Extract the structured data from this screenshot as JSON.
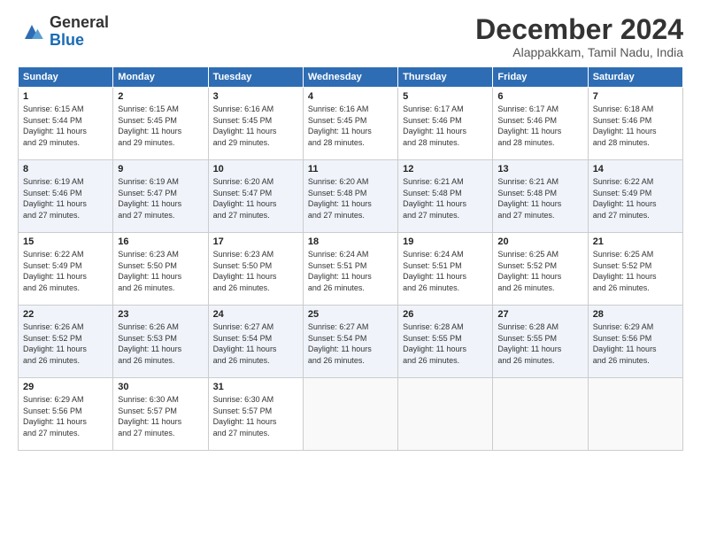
{
  "header": {
    "logo_general": "General",
    "logo_blue": "Blue",
    "title": "December 2024",
    "location": "Alappakkam, Tamil Nadu, India"
  },
  "calendar": {
    "days_of_week": [
      "Sunday",
      "Monday",
      "Tuesday",
      "Wednesday",
      "Thursday",
      "Friday",
      "Saturday"
    ],
    "weeks": [
      [
        {
          "day": "1",
          "info": "Sunrise: 6:15 AM\nSunset: 5:44 PM\nDaylight: 11 hours\nand 29 minutes."
        },
        {
          "day": "2",
          "info": "Sunrise: 6:15 AM\nSunset: 5:45 PM\nDaylight: 11 hours\nand 29 minutes."
        },
        {
          "day": "3",
          "info": "Sunrise: 6:16 AM\nSunset: 5:45 PM\nDaylight: 11 hours\nand 29 minutes."
        },
        {
          "day": "4",
          "info": "Sunrise: 6:16 AM\nSunset: 5:45 PM\nDaylight: 11 hours\nand 28 minutes."
        },
        {
          "day": "5",
          "info": "Sunrise: 6:17 AM\nSunset: 5:46 PM\nDaylight: 11 hours\nand 28 minutes."
        },
        {
          "day": "6",
          "info": "Sunrise: 6:17 AM\nSunset: 5:46 PM\nDaylight: 11 hours\nand 28 minutes."
        },
        {
          "day": "7",
          "info": "Sunrise: 6:18 AM\nSunset: 5:46 PM\nDaylight: 11 hours\nand 28 minutes."
        }
      ],
      [
        {
          "day": "8",
          "info": "Sunrise: 6:19 AM\nSunset: 5:46 PM\nDaylight: 11 hours\nand 27 minutes."
        },
        {
          "day": "9",
          "info": "Sunrise: 6:19 AM\nSunset: 5:47 PM\nDaylight: 11 hours\nand 27 minutes."
        },
        {
          "day": "10",
          "info": "Sunrise: 6:20 AM\nSunset: 5:47 PM\nDaylight: 11 hours\nand 27 minutes."
        },
        {
          "day": "11",
          "info": "Sunrise: 6:20 AM\nSunset: 5:48 PM\nDaylight: 11 hours\nand 27 minutes."
        },
        {
          "day": "12",
          "info": "Sunrise: 6:21 AM\nSunset: 5:48 PM\nDaylight: 11 hours\nand 27 minutes."
        },
        {
          "day": "13",
          "info": "Sunrise: 6:21 AM\nSunset: 5:48 PM\nDaylight: 11 hours\nand 27 minutes."
        },
        {
          "day": "14",
          "info": "Sunrise: 6:22 AM\nSunset: 5:49 PM\nDaylight: 11 hours\nand 27 minutes."
        }
      ],
      [
        {
          "day": "15",
          "info": "Sunrise: 6:22 AM\nSunset: 5:49 PM\nDaylight: 11 hours\nand 26 minutes."
        },
        {
          "day": "16",
          "info": "Sunrise: 6:23 AM\nSunset: 5:50 PM\nDaylight: 11 hours\nand 26 minutes."
        },
        {
          "day": "17",
          "info": "Sunrise: 6:23 AM\nSunset: 5:50 PM\nDaylight: 11 hours\nand 26 minutes."
        },
        {
          "day": "18",
          "info": "Sunrise: 6:24 AM\nSunset: 5:51 PM\nDaylight: 11 hours\nand 26 minutes."
        },
        {
          "day": "19",
          "info": "Sunrise: 6:24 AM\nSunset: 5:51 PM\nDaylight: 11 hours\nand 26 minutes."
        },
        {
          "day": "20",
          "info": "Sunrise: 6:25 AM\nSunset: 5:52 PM\nDaylight: 11 hours\nand 26 minutes."
        },
        {
          "day": "21",
          "info": "Sunrise: 6:25 AM\nSunset: 5:52 PM\nDaylight: 11 hours\nand 26 minutes."
        }
      ],
      [
        {
          "day": "22",
          "info": "Sunrise: 6:26 AM\nSunset: 5:52 PM\nDaylight: 11 hours\nand 26 minutes."
        },
        {
          "day": "23",
          "info": "Sunrise: 6:26 AM\nSunset: 5:53 PM\nDaylight: 11 hours\nand 26 minutes."
        },
        {
          "day": "24",
          "info": "Sunrise: 6:27 AM\nSunset: 5:54 PM\nDaylight: 11 hours\nand 26 minutes."
        },
        {
          "day": "25",
          "info": "Sunrise: 6:27 AM\nSunset: 5:54 PM\nDaylight: 11 hours\nand 26 minutes."
        },
        {
          "day": "26",
          "info": "Sunrise: 6:28 AM\nSunset: 5:55 PM\nDaylight: 11 hours\nand 26 minutes."
        },
        {
          "day": "27",
          "info": "Sunrise: 6:28 AM\nSunset: 5:55 PM\nDaylight: 11 hours\nand 26 minutes."
        },
        {
          "day": "28",
          "info": "Sunrise: 6:29 AM\nSunset: 5:56 PM\nDaylight: 11 hours\nand 26 minutes."
        }
      ],
      [
        {
          "day": "29",
          "info": "Sunrise: 6:29 AM\nSunset: 5:56 PM\nDaylight: 11 hours\nand 27 minutes."
        },
        {
          "day": "30",
          "info": "Sunrise: 6:30 AM\nSunset: 5:57 PM\nDaylight: 11 hours\nand 27 minutes."
        },
        {
          "day": "31",
          "info": "Sunrise: 6:30 AM\nSunset: 5:57 PM\nDaylight: 11 hours\nand 27 minutes."
        },
        {
          "day": "",
          "info": ""
        },
        {
          "day": "",
          "info": ""
        },
        {
          "day": "",
          "info": ""
        },
        {
          "day": "",
          "info": ""
        }
      ]
    ]
  }
}
